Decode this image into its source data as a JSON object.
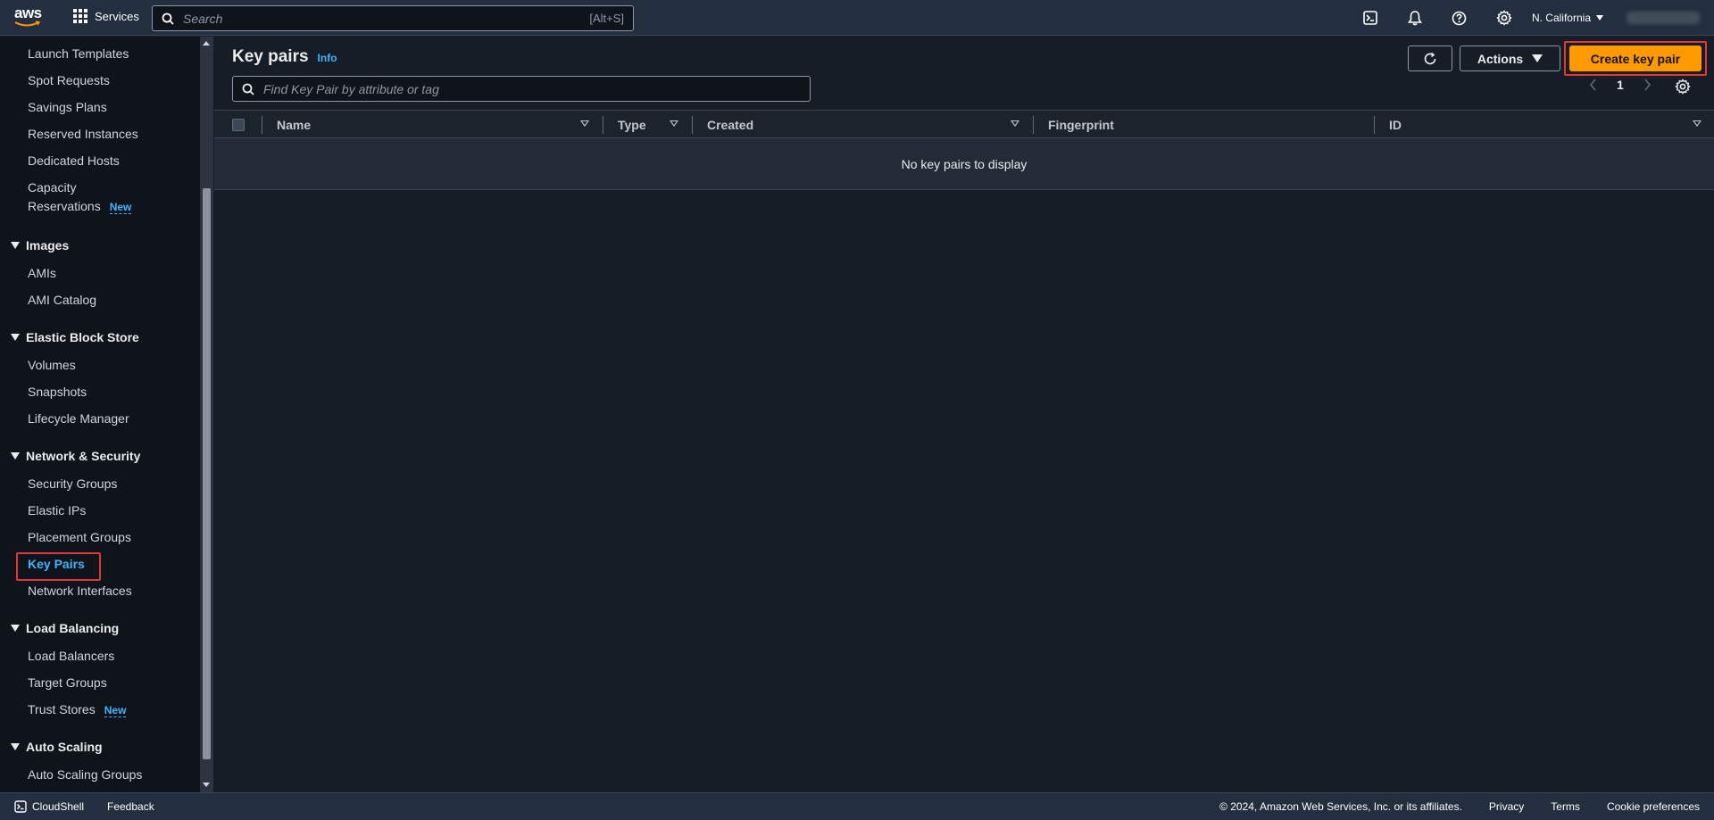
{
  "topnav": {
    "logo_text": "aws",
    "services_label": "Services",
    "search_placeholder": "Search",
    "search_shortcut": "[Alt+S]",
    "region": "N. California"
  },
  "sidebar": {
    "items": {
      "launch_templates": "Launch Templates",
      "spot_requests": "Spot Requests",
      "savings_plans": "Savings Plans",
      "reserved_instances": "Reserved Instances",
      "dedicated_hosts": "Dedicated Hosts",
      "capacity_reservations_1": "Capacity",
      "capacity_reservations_2": "Reservations",
      "amis": "AMIs",
      "ami_catalog": "AMI Catalog",
      "volumes": "Volumes",
      "snapshots": "Snapshots",
      "lifecycle_manager": "Lifecycle Manager",
      "security_groups": "Security Groups",
      "elastic_ips": "Elastic IPs",
      "placement_groups": "Placement Groups",
      "key_pairs": "Key Pairs",
      "network_interfaces": "Network Interfaces",
      "load_balancers": "Load Balancers",
      "target_groups": "Target Groups",
      "trust_stores": "Trust Stores",
      "auto_scaling_groups": "Auto Scaling Groups"
    },
    "sections": {
      "images": "Images",
      "ebs": "Elastic Block Store",
      "network_security": "Network & Security",
      "load_balancing": "Load Balancing",
      "auto_scaling": "Auto Scaling"
    },
    "new_badge": "New"
  },
  "main": {
    "title": "Key pairs",
    "info": "Info",
    "actions_label": "Actions",
    "create_label": "Create key pair",
    "filter_placeholder": "Find Key Pair by attribute or tag",
    "page_number": "1",
    "columns": {
      "name": "Name",
      "type": "Type",
      "created": "Created",
      "fingerprint": "Fingerprint",
      "id": "ID"
    },
    "empty_text": "No key pairs to display"
  },
  "footer": {
    "cloudshell": "CloudShell",
    "feedback": "Feedback",
    "copyright": "© 2024, Amazon Web Services, Inc. or its affiliates.",
    "privacy": "Privacy",
    "terms": "Terms",
    "cookies": "Cookie preferences"
  },
  "colors": {
    "primary_button": "#ff9900",
    "link": "#42b4ff",
    "highlight_box": "#e0373d"
  }
}
